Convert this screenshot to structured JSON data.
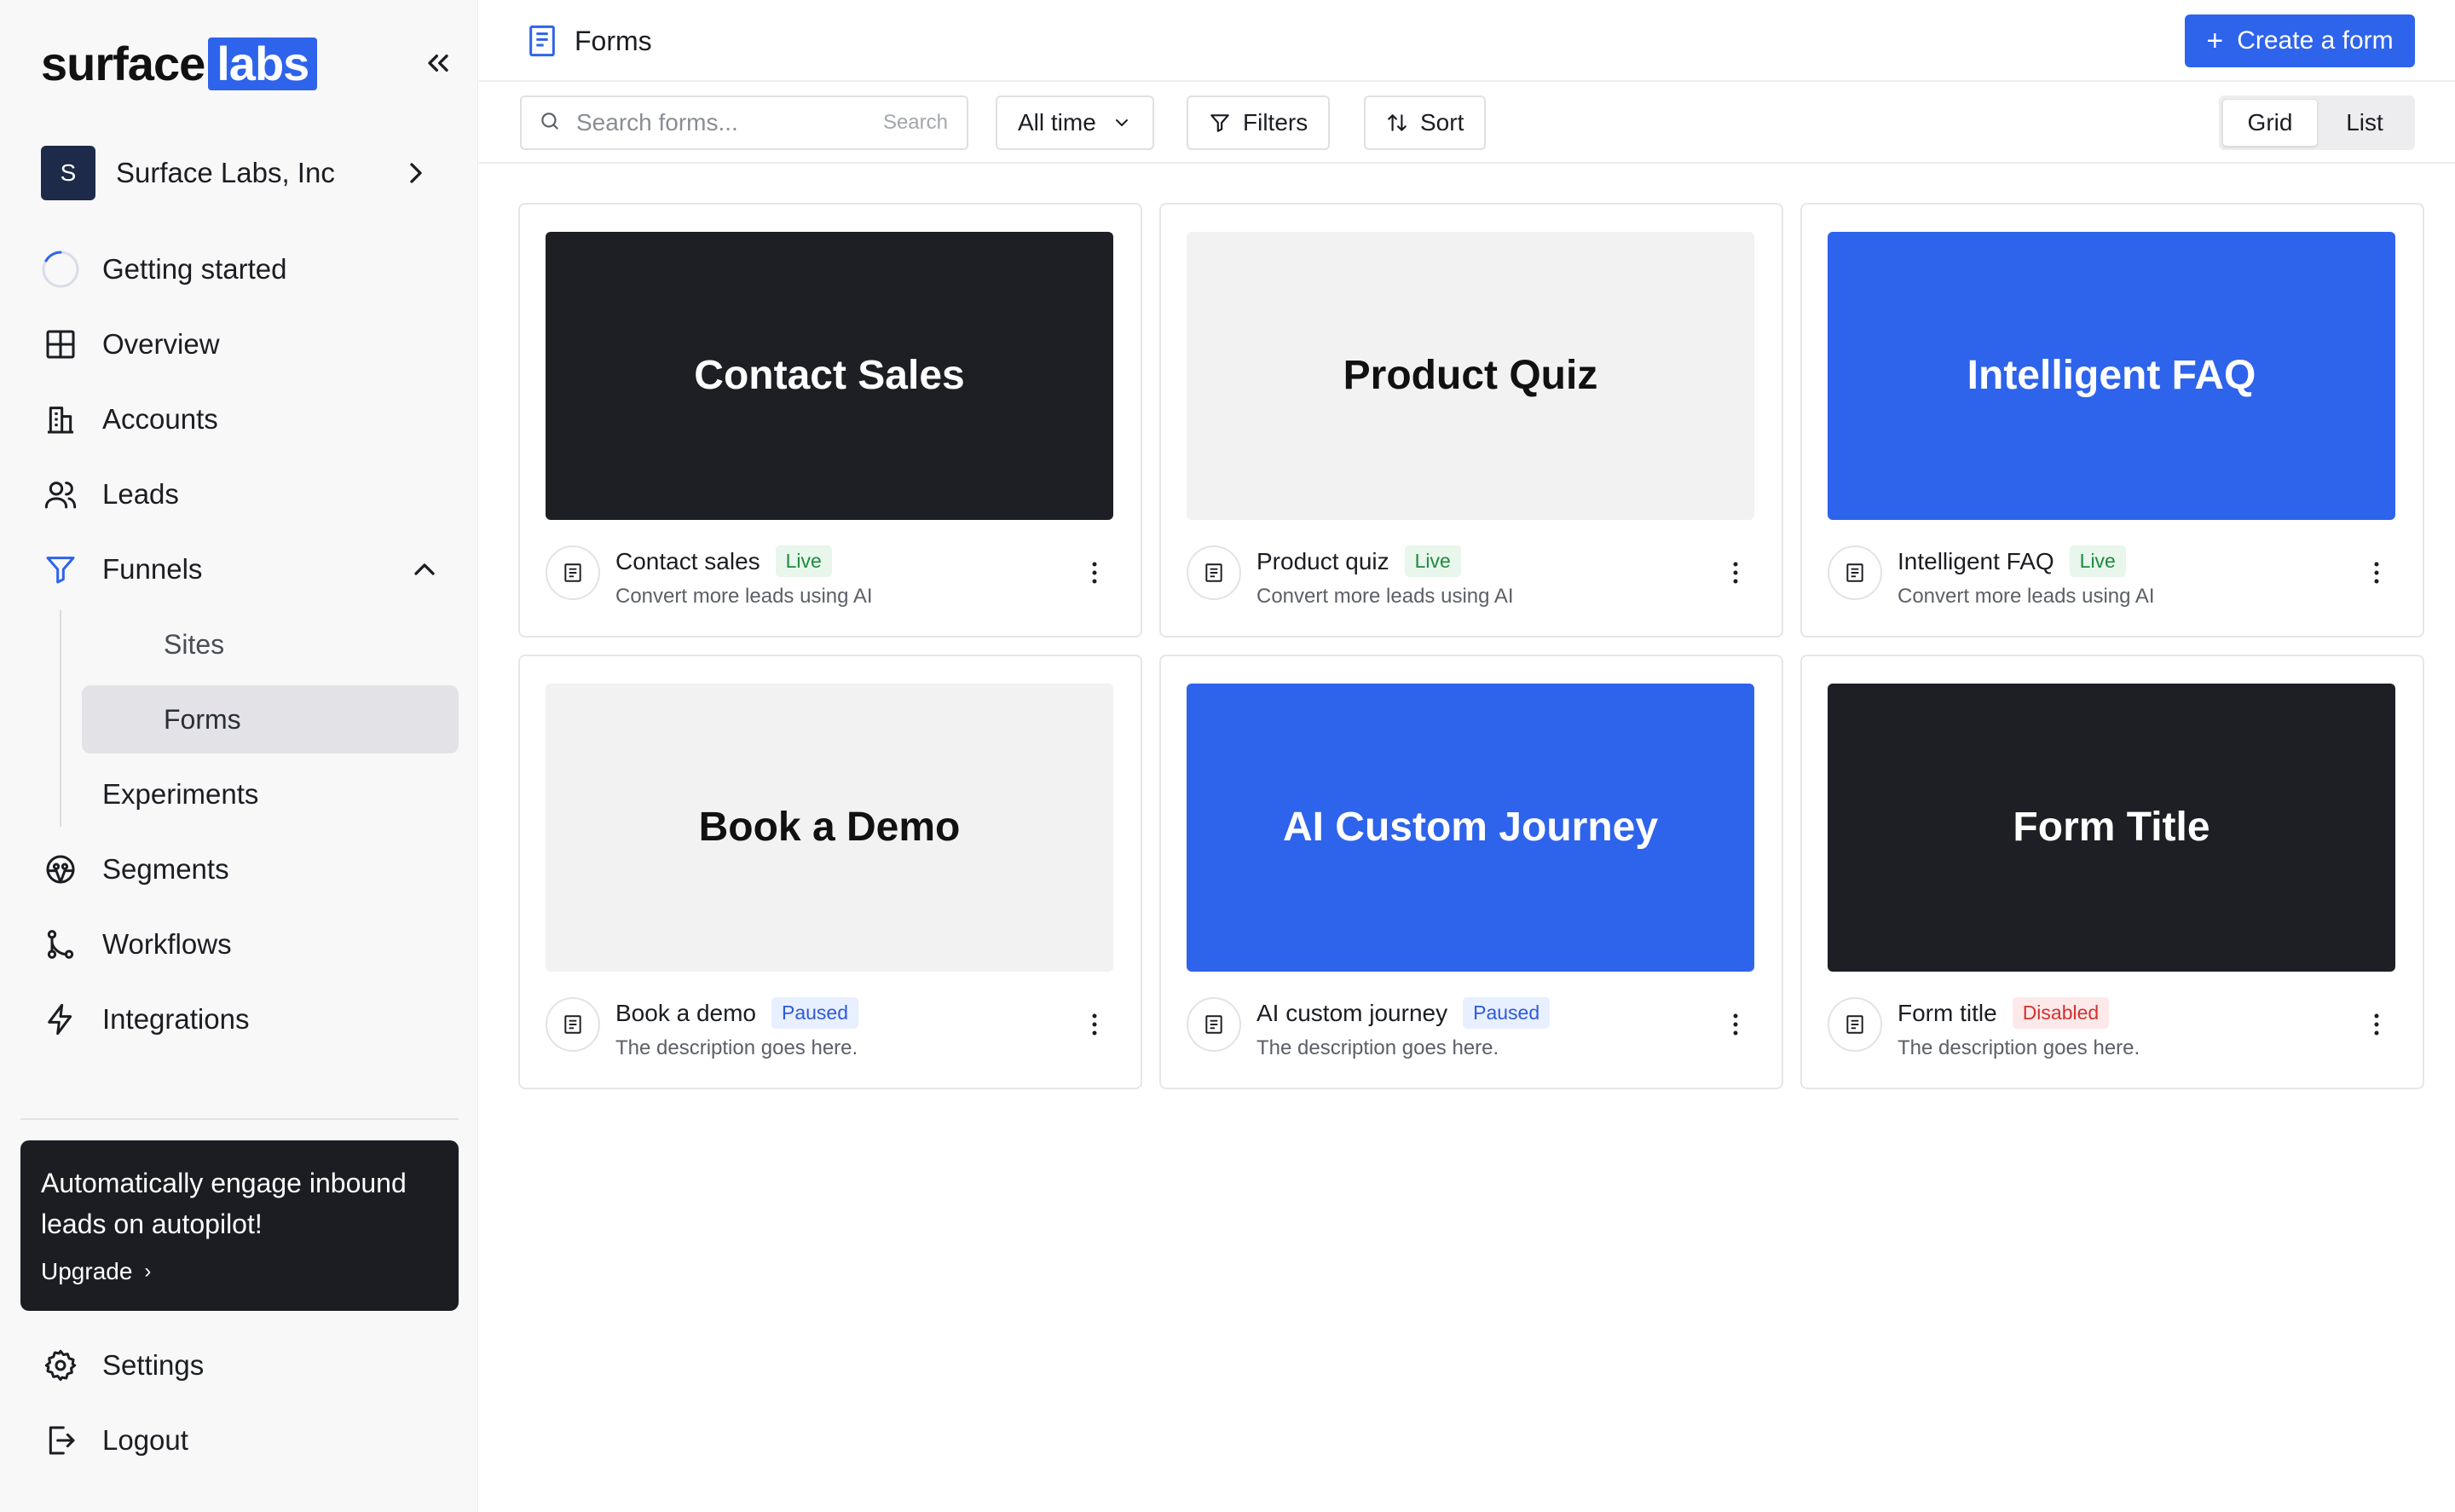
{
  "brand": {
    "logo_word": "surface",
    "logo_badge": "labs",
    "accent": "#2e63eb"
  },
  "org": {
    "initial": "S",
    "name": "Surface Labs, Inc"
  },
  "nav": {
    "getting_started": "Getting started",
    "overview": "Overview",
    "accounts": "Accounts",
    "leads": "Leads",
    "funnels": "Funnels",
    "sites": "Sites",
    "forms": "Forms",
    "experiments": "Experiments",
    "segments": "Segments",
    "workflows": "Workflows",
    "integrations": "Integrations",
    "settings": "Settings",
    "logout": "Logout"
  },
  "promo": {
    "text": "Automatically engage inbound leads on autopilot!",
    "link": "Upgrade"
  },
  "header": {
    "title": "Forms",
    "create_label": "Create a form"
  },
  "toolbar": {
    "search_placeholder": "Search forms...",
    "search_hint": "Search",
    "time_range": "All time",
    "filters": "Filters",
    "sort": "Sort",
    "view_grid": "Grid",
    "view_list": "List",
    "active_view": "Grid"
  },
  "cards": [
    {
      "preview_title": "Contact Sales",
      "name": "Contact sales",
      "status": "Live",
      "description": "Convert more leads using AI",
      "theme": "dark"
    },
    {
      "preview_title": "Product Quiz",
      "name": "Product quiz",
      "status": "Live",
      "description": "Convert more leads using AI",
      "theme": "light"
    },
    {
      "preview_title": "Intelligent FAQ",
      "name": "Intelligent FAQ",
      "status": "Live",
      "description": "Convert more leads using AI",
      "theme": "blue"
    },
    {
      "preview_title": "Book a Demo",
      "name": "Book a demo",
      "status": "Paused",
      "description": "The description goes here.",
      "theme": "light"
    },
    {
      "preview_title": "AI Custom Journey",
      "name": "AI custom journey",
      "status": "Paused",
      "description": "The description goes here.",
      "theme": "blue"
    },
    {
      "preview_title": "Form Title",
      "name": "Form title",
      "status": "Disabled",
      "description": "The description goes here.",
      "theme": "dark"
    }
  ]
}
